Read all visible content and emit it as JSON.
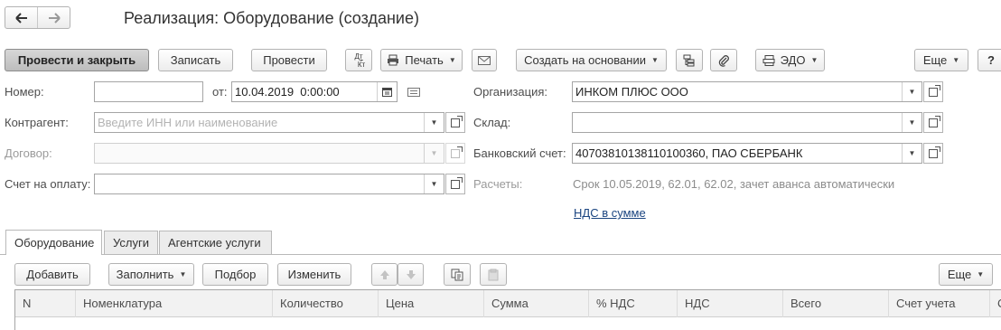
{
  "window": {
    "title": "Реализация: Оборудование (создание)"
  },
  "nav": {
    "back_icon": "arrow-left-icon",
    "forward_icon": "arrow-right-icon"
  },
  "toolbar": {
    "post_and_close": "Провести и закрыть",
    "save": "Записать",
    "post": "Провести",
    "dt_kt_top": "Дт",
    "dt_kt_bottom": "Кт",
    "print": "Печать",
    "create_based_on": "Создать на основании",
    "edo": "ЭДО",
    "more": "Еще",
    "help": "?"
  },
  "form": {
    "number_label": "Номер:",
    "number_value": "",
    "date_label": "от:",
    "date_value": "10.04.2019  0:00:00",
    "counterparty_label": "Контрагент:",
    "counterparty_placeholder": "Введите ИНН или наименование",
    "contract_label": "Договор:",
    "contract_value": "",
    "invoice_label": "Счет на оплату:",
    "invoice_value": "",
    "organization_label": "Организация:",
    "organization_value": "ИНКОМ ПЛЮС ООО",
    "warehouse_label": "Склад:",
    "warehouse_value": "",
    "bank_account_label": "Банковский счет:",
    "bank_account_value": "40703810138110100360, ПАО СБЕРБАНК",
    "settlements_label": "Расчеты:",
    "settlements_value": "Срок 10.05.2019, 62.01, 62.02, зачет аванса автоматически",
    "vat_link": "НДС в сумме"
  },
  "tabs": [
    {
      "label": "Оборудование",
      "active": true
    },
    {
      "label": "Услуги",
      "active": false
    },
    {
      "label": "Агентские услуги",
      "active": false
    }
  ],
  "table_toolbar": {
    "add": "Добавить",
    "fill": "Заполнить",
    "selection": "Подбор",
    "change": "Изменить",
    "more": "Еще"
  },
  "table": {
    "columns": [
      "N",
      "Номенклатура",
      "Количество",
      "Цена",
      "Сумма",
      "% НДС",
      "НДС",
      "Всего",
      "Счет учета",
      "С"
    ]
  },
  "colors": {
    "primary_button": "#c4c4c4",
    "link": "#1a4480",
    "border": "#a5a5a5"
  }
}
